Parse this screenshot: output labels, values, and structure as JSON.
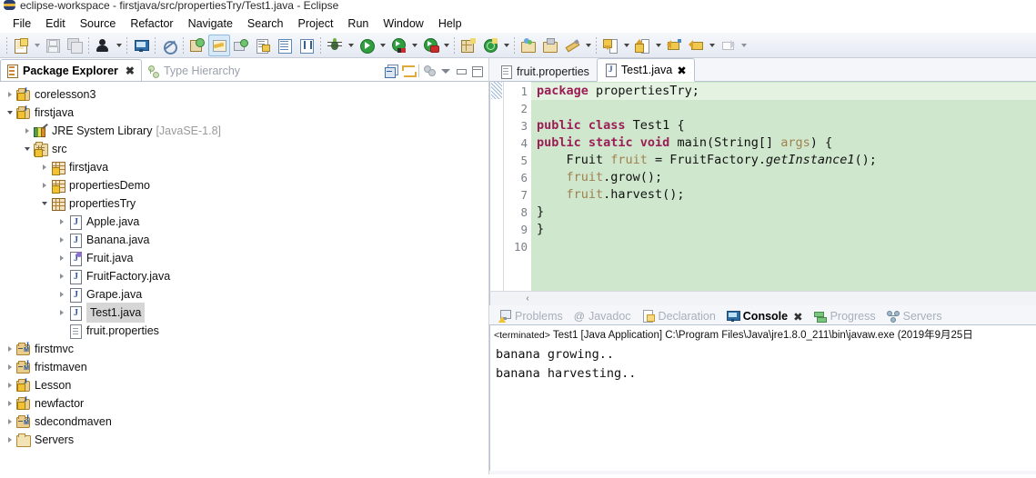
{
  "window": {
    "title": "eclipse-workspace - firstjava/src/propertiesTry/Test1.java - Eclipse",
    "icon": "eclipse-logo-icon"
  },
  "menu": {
    "items": [
      "File",
      "Edit",
      "Source",
      "Refactor",
      "Navigate",
      "Search",
      "Project",
      "Run",
      "Window",
      "Help"
    ]
  },
  "toolbar": {
    "groups": [
      {
        "buttons": [
          {
            "name": "new-wizard-button",
            "icon": "new-file-icon",
            "dropdown": true,
            "active": false
          },
          {
            "name": "save-button",
            "icon": "save-disk-icon",
            "dropdown": false,
            "active": false,
            "disabled": true
          },
          {
            "name": "save-all-button",
            "icon": "save-all-icon",
            "dropdown": false,
            "active": false,
            "disabled": true
          }
        ]
      },
      {
        "buttons": [
          {
            "name": "user-button",
            "icon": "person-icon",
            "dropdown": true,
            "active": false
          }
        ]
      },
      {
        "buttons": [
          {
            "name": "open-console-button",
            "icon": "console-monitor-icon",
            "dropdown": false,
            "active": false
          }
        ]
      },
      {
        "buttons": [
          {
            "name": "skip-breakpoints-button",
            "icon": "skip-breakpoint-icon",
            "dropdown": false,
            "active": false
          }
        ]
      },
      {
        "buttons": [
          {
            "name": "new-java-package-button",
            "icon": "new-package-icon",
            "dropdown": false,
            "active": false
          },
          {
            "name": "new-java-class-button",
            "icon": "java-class-brush-icon",
            "dropdown": false,
            "active": true
          },
          {
            "name": "new-annotation-button",
            "icon": "new-annotation-icon",
            "dropdown": false,
            "active": false
          },
          {
            "name": "open-type-button",
            "icon": "open-type-icon",
            "dropdown": false,
            "active": false
          },
          {
            "name": "toggle-block-selection-button",
            "icon": "block-selection-icon",
            "dropdown": false,
            "active": false
          },
          {
            "name": "show-whitespace-button",
            "icon": "pilcrow-icon",
            "dropdown": false,
            "active": false
          }
        ]
      },
      {
        "buttons": [
          {
            "name": "debug-button",
            "icon": "bug-icon",
            "dropdown": true,
            "active": false
          },
          {
            "name": "run-button",
            "icon": "run-green-play-icon",
            "dropdown": true,
            "active": false
          },
          {
            "name": "coverage-button",
            "icon": "coverage-icon",
            "dropdown": true,
            "active": false
          },
          {
            "name": "run-external-tools-button",
            "icon": "external-tools-icon",
            "dropdown": true,
            "active": false
          }
        ]
      },
      {
        "buttons": [
          {
            "name": "new-java-project-button",
            "icon": "new-java-project-icon",
            "dropdown": false,
            "active": false
          },
          {
            "name": "new-dynamic-web-project-button",
            "icon": "new-web-project-icon",
            "dropdown": true,
            "active": false
          }
        ]
      },
      {
        "buttons": [
          {
            "name": "open-perspective-button",
            "icon": "open-perspective-icon",
            "dropdown": false,
            "active": false
          },
          {
            "name": "open-task-button",
            "icon": "open-task-icon",
            "dropdown": false,
            "active": false
          },
          {
            "name": "search-button",
            "icon": "pencil-search-icon",
            "dropdown": true,
            "active": false
          }
        ]
      },
      {
        "buttons": [
          {
            "name": "next-annotation-button",
            "icon": "next-annotation-down-icon",
            "dropdown": true,
            "active": false
          },
          {
            "name": "previous-annotation-button",
            "icon": "previous-annotation-up-icon",
            "dropdown": true,
            "active": false
          },
          {
            "name": "last-edit-location-button",
            "icon": "last-edit-arrow-icon",
            "dropdown": false,
            "active": false
          },
          {
            "name": "back-button",
            "icon": "back-arrow-icon",
            "dropdown": true,
            "active": false
          },
          {
            "name": "forward-button",
            "icon": "forward-arrow-icon",
            "dropdown": true,
            "active": false,
            "disabled": true
          }
        ]
      }
    ]
  },
  "package_explorer": {
    "tabs": [
      {
        "label": "Package Explorer",
        "icon": "package-explorer-icon",
        "active": true,
        "closeable": true
      },
      {
        "label": "Type Hierarchy",
        "icon": "type-hierarchy-icon",
        "active": false,
        "closeable": false
      }
    ],
    "view_tools": [
      {
        "name": "collapse-all-button",
        "icon": "collapse-all-icon"
      },
      {
        "name": "link-with-editor-button",
        "icon": "link-editor-icon"
      },
      {
        "name": "view-menu-button",
        "icon": "view-menu-icon"
      },
      {
        "name": "view-dropdown-button",
        "icon": "chevron-down-icon"
      },
      {
        "name": "minimize-view-button",
        "icon": "minimize-icon"
      },
      {
        "name": "maximize-view-button",
        "icon": "maximize-icon"
      }
    ],
    "tree": [
      {
        "label": "corelesson3",
        "indent": 0,
        "twisty": "collapsed",
        "icon": "java-project-warning-icon",
        "selected": false
      },
      {
        "label": "firstjava",
        "indent": 0,
        "twisty": "expanded",
        "icon": "java-project-warning-icon",
        "selected": false
      },
      {
        "label": "JRE System Library",
        "sub": "[JavaSE-1.8]",
        "indent": 1,
        "twisty": "collapsed",
        "icon": "jre-library-icon",
        "selected": false
      },
      {
        "label": "src",
        "indent": 1,
        "twisty": "expanded",
        "icon": "source-folder-warning-icon",
        "selected": false
      },
      {
        "label": "firstjava",
        "indent": 2,
        "twisty": "collapsed",
        "icon": "package-warning-icon",
        "selected": false
      },
      {
        "label": "propertiesDemo",
        "indent": 2,
        "twisty": "collapsed",
        "icon": "package-warning-icon",
        "selected": false
      },
      {
        "label": "propertiesTry",
        "indent": 2,
        "twisty": "expanded",
        "icon": "package-icon",
        "selected": false
      },
      {
        "label": "Apple.java",
        "indent": 3,
        "twisty": "collapsed",
        "icon": "java-file-icon",
        "selected": false
      },
      {
        "label": "Banana.java",
        "indent": 3,
        "twisty": "collapsed",
        "icon": "java-file-icon",
        "selected": false
      },
      {
        "label": "Fruit.java",
        "indent": 3,
        "twisty": "collapsed",
        "icon": "java-interface-icon",
        "selected": false
      },
      {
        "label": "FruitFactory.java",
        "indent": 3,
        "twisty": "collapsed",
        "icon": "java-file-icon",
        "selected": false
      },
      {
        "label": "Grape.java",
        "indent": 3,
        "twisty": "collapsed",
        "icon": "java-file-icon",
        "selected": false
      },
      {
        "label": "Test1.java",
        "indent": 3,
        "twisty": "collapsed",
        "icon": "java-file-icon",
        "selected": true
      },
      {
        "label": "fruit.properties",
        "indent": 3,
        "twisty": "none",
        "icon": "properties-file-icon",
        "selected": false
      },
      {
        "label": "firstmvc",
        "indent": 0,
        "twisty": "collapsed",
        "icon": "maven-project-icon",
        "selected": false
      },
      {
        "label": "fristmaven",
        "indent": 0,
        "twisty": "collapsed",
        "icon": "maven-project-icon",
        "selected": false
      },
      {
        "label": "Lesson",
        "indent": 0,
        "twisty": "collapsed",
        "icon": "java-project-warning-icon",
        "selected": false
      },
      {
        "label": "newfactor",
        "indent": 0,
        "twisty": "collapsed",
        "icon": "java-project-warning-icon",
        "selected": false
      },
      {
        "label": "sdecondmaven",
        "indent": 0,
        "twisty": "collapsed",
        "icon": "maven-project-icon",
        "selected": false
      },
      {
        "label": "Servers",
        "indent": 0,
        "twisty": "collapsed",
        "icon": "folder-icon",
        "selected": false
      }
    ]
  },
  "editor": {
    "tabs": [
      {
        "label": "fruit.properties",
        "icon": "properties-file-icon",
        "active": false,
        "closeable": false
      },
      {
        "label": "Test1.java",
        "icon": "java-file-icon",
        "active": true,
        "closeable": true
      }
    ],
    "background_color": "#cfe8cd",
    "current_line_color": "#e4f2e1",
    "lines": [
      {
        "n": "1",
        "current": true,
        "fold": false,
        "tokens": [
          {
            "t": "package ",
            "c": "kw"
          },
          {
            "t": "propertiesTry;",
            "c": "typ"
          }
        ]
      },
      {
        "n": "2",
        "current": false,
        "fold": false,
        "tokens": []
      },
      {
        "n": "3",
        "current": false,
        "fold": false,
        "tokens": [
          {
            "t": "public class ",
            "c": "kw"
          },
          {
            "t": "Test1 {",
            "c": "typ"
          }
        ]
      },
      {
        "n": "4",
        "current": false,
        "fold": true,
        "tokens": [
          {
            "t": "public static void ",
            "c": "kw"
          },
          {
            "t": "main(String[] ",
            "c": "typ"
          },
          {
            "t": "args",
            "c": "lv"
          },
          {
            "t": ") {",
            "c": "typ"
          }
        ]
      },
      {
        "n": "5",
        "current": false,
        "fold": false,
        "tokens": [
          {
            "t": "    Fruit ",
            "c": "typ"
          },
          {
            "t": "fruit",
            "c": "lv"
          },
          {
            "t": " = FruitFactory.",
            "c": "typ"
          },
          {
            "t": "getInstance1",
            "c": "mth"
          },
          {
            "t": "();",
            "c": "typ"
          }
        ]
      },
      {
        "n": "6",
        "current": false,
        "fold": false,
        "tokens": [
          {
            "t": "    ",
            "c": "typ"
          },
          {
            "t": "fruit",
            "c": "lv"
          },
          {
            "t": ".grow();",
            "c": "typ"
          }
        ]
      },
      {
        "n": "7",
        "current": false,
        "fold": false,
        "tokens": [
          {
            "t": "    ",
            "c": "typ"
          },
          {
            "t": "fruit",
            "c": "lv"
          },
          {
            "t": ".harvest();",
            "c": "typ"
          }
        ]
      },
      {
        "n": "8",
        "current": false,
        "fold": false,
        "tokens": [
          {
            "t": "}",
            "c": "typ"
          }
        ]
      },
      {
        "n": "9",
        "current": false,
        "fold": false,
        "tokens": [
          {
            "t": "}",
            "c": "typ"
          }
        ]
      },
      {
        "n": "10",
        "current": false,
        "fold": false,
        "tokens": []
      }
    ],
    "hscroll_glyph": "‹"
  },
  "console": {
    "tabs": [
      {
        "label": "Problems",
        "icon": "problems-icon",
        "active": false,
        "closeable": false
      },
      {
        "label": "Javadoc",
        "icon": "javadoc-at-icon",
        "active": false,
        "closeable": false
      },
      {
        "label": "Declaration",
        "icon": "declaration-icon",
        "active": false,
        "closeable": false
      },
      {
        "label": "Console",
        "icon": "console-icon",
        "active": true,
        "closeable": true
      },
      {
        "label": "Progress",
        "icon": "progress-icon",
        "active": false,
        "closeable": false
      },
      {
        "label": "Servers",
        "icon": "servers-icon",
        "active": false,
        "closeable": false
      }
    ],
    "status_prefix": "<terminated>",
    "status_line": " Test1 [Java Application] C:\\Program Files\\Java\\jre1.8.0_211\\bin\\javaw.exe (2019年9月25日",
    "output": "banana growing..\nbanana harvesting.."
  }
}
